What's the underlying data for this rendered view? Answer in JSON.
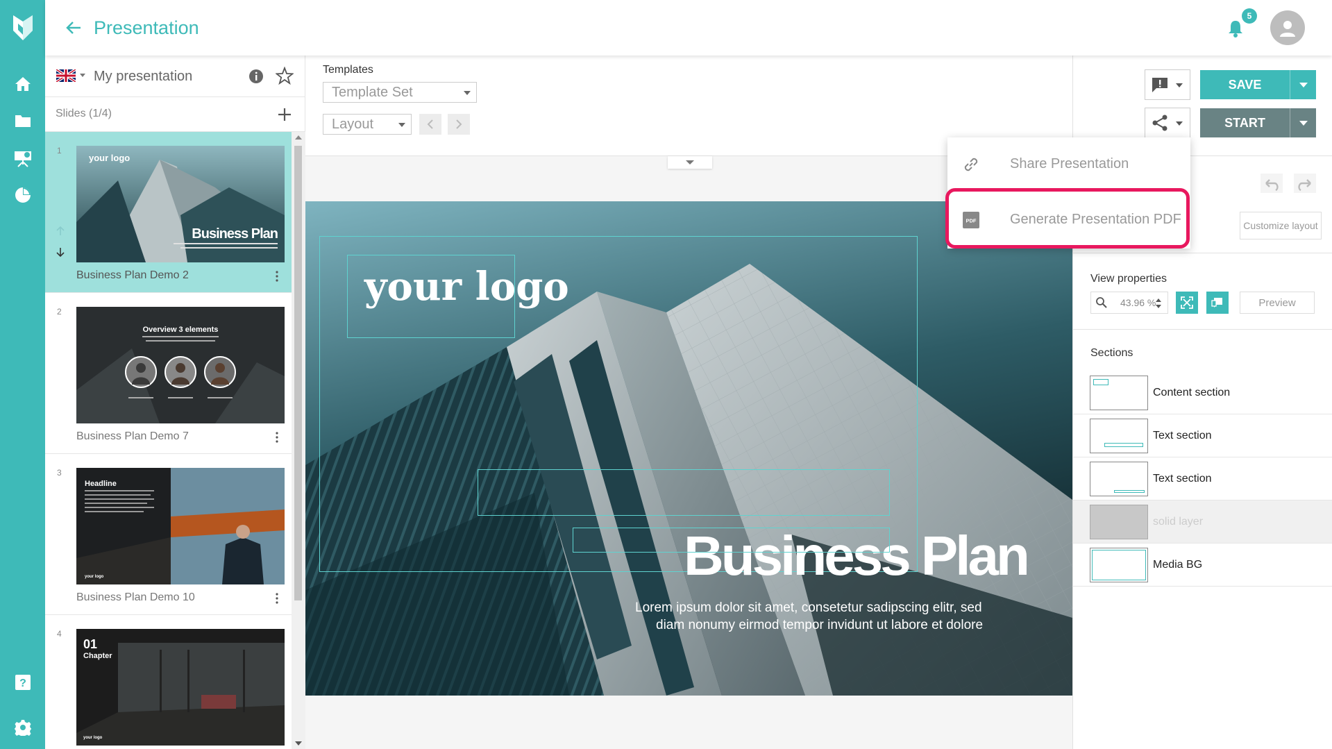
{
  "header": {
    "title": "Presentation",
    "notification_count": "5"
  },
  "sidebar_left": {
    "presentation_name": "My presentation",
    "slides_count": "Slides (1/4)",
    "slides": [
      {
        "number": "1",
        "name": "Business Plan Demo 2",
        "active": true
      },
      {
        "number": "2",
        "name": "Business Plan Demo 7",
        "active": false
      },
      {
        "number": "3",
        "name": "Business Plan Demo 10",
        "active": false
      },
      {
        "number": "4",
        "name": "",
        "active": false
      }
    ],
    "thumbs": {
      "t1_logo": "your logo",
      "t1_title": "Business Plan",
      "t2_title": "Overview 3 elements",
      "t3_title": "Headline",
      "t3_logo": "your logo",
      "t4_num": "01",
      "t4_title": "Chapter",
      "t4_logo": "your logo"
    }
  },
  "toolbar": {
    "templates_label": "Templates",
    "template_set_value": "Template Set",
    "layout_value": "Layout"
  },
  "canvas": {
    "logo_text": "your logo",
    "headline": "Business Plan",
    "body_line1": "Lorem ipsum dolor sit amet, consetetur sadipscing elitr, sed",
    "body_line2": "diam nonumy eirmod tempor invidunt ut labore et dolore"
  },
  "right_panel": {
    "save_label": "SAVE",
    "start_label": "START",
    "customize_layout_label": "Customize layout",
    "view_properties_label": "View properties",
    "zoom_value": "43.96 %",
    "preview_label": "Preview",
    "sections_label": "Sections",
    "sections": [
      {
        "name": "Content section"
      },
      {
        "name": "Text section"
      },
      {
        "name": "Text section"
      },
      {
        "name": "solid layer"
      },
      {
        "name": "Media BG"
      }
    ]
  },
  "share_menu": {
    "share_label": "Share Presentation",
    "pdf_label": "Generate Presentation PDF",
    "pdf_icon_text": "PDF"
  },
  "colors": {
    "accent": "#3ebab8",
    "start_button": "#698384",
    "highlight": "#e8185e"
  },
  "icons": [
    "logo-icon",
    "home-icon",
    "folder-icon",
    "presentation-icon",
    "pie-chart-icon",
    "help-icon",
    "gear-icon",
    "back-arrow-icon",
    "bell-icon",
    "user-icon",
    "info-icon",
    "star-icon",
    "plus-icon",
    "link-icon",
    "pdf-icon",
    "share-icon",
    "comment-icon",
    "undo-icon",
    "redo-icon",
    "magnifier-icon",
    "fullscreen-icon",
    "comment-view-icon"
  ]
}
